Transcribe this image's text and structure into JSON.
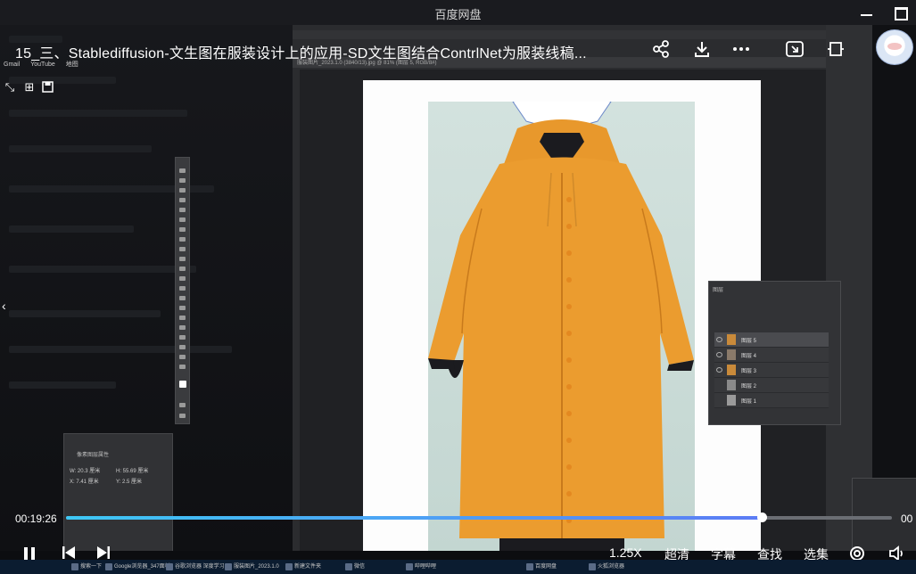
{
  "app": {
    "window_title": "百度网盘"
  },
  "video": {
    "title": "15_三、Stablediffusion-文生图在服装设计上的应用-SD文生图结合ContrlNet为服装线稿...",
    "current_time": "00:19:26",
    "end_time": "00",
    "progress": 0.842,
    "buffered": 0.842
  },
  "top_actions": [
    "share-icon",
    "download-icon",
    "more-icon",
    "pip-icon",
    "fullscreen-icon"
  ],
  "bookmarks": [
    "Gmail",
    "YouTube",
    "地图"
  ],
  "controls": {
    "speed": "1.25X",
    "quality": "超清",
    "subtitle": "字幕",
    "search": "查找",
    "playlist": "选集"
  },
  "photoshop": {
    "doc_tab": "服装图片_2023.1.0 (3840/13).jpg @ 81% (图层 5, RGB/8#)",
    "properties_title": "像素图层属性",
    "props": [
      "W: 20.3 厘米",
      "H: 55.69 厘米",
      "X: 7.41 厘米",
      "Y: 2.5 厘米"
    ],
    "layers_title": "图层",
    "layers": [
      "图层 5",
      "图层 4",
      "图层 3",
      "图层 2",
      "图层 1"
    ]
  },
  "taskbar": [
    "搜索一下",
    "Google浏览器_347面板",
    "谷歌浏览器 深度学习",
    "服装图片_2023.1.0",
    "新建文件夹",
    "微信",
    "哔哩哔哩",
    "百度网盘",
    "火狐浏览器"
  ],
  "colors": {
    "accent": "#3ec8f5",
    "coat": "#e99a2e",
    "bg": "#0c0d10"
  }
}
